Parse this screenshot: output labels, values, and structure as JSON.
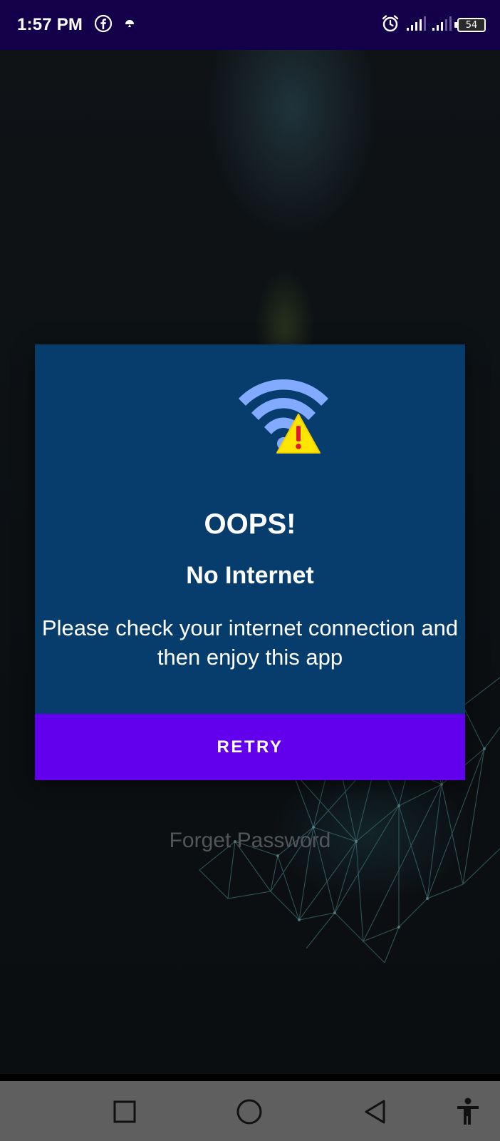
{
  "status_bar": {
    "time": "1:57 PM",
    "battery": "54",
    "icons": [
      "facebook-icon",
      "notification-icon",
      "alarm-icon",
      "signal-icon",
      "signal-icon",
      "battery-icon"
    ]
  },
  "background": {
    "forget_password": "Forget Password"
  },
  "dialog": {
    "icon": "wifi-warning-icon",
    "title": "OOPS!",
    "subtitle": "No Internet",
    "message": "Please check your internet connection and then enjoy this app",
    "retry_label": "RETRY"
  },
  "nav_bar": {
    "icons": [
      "recents-icon",
      "home-icon",
      "back-icon",
      "accessibility-icon"
    ]
  },
  "colors": {
    "status_bar": "#14004a",
    "dialog_bg": "#073d6c",
    "retry_bg": "#6200ee",
    "nav_bar": "#5f5f5f",
    "wifi_blue": "#82aaff",
    "warning_yellow": "#ffe600",
    "warning_red": "#e3172b"
  }
}
